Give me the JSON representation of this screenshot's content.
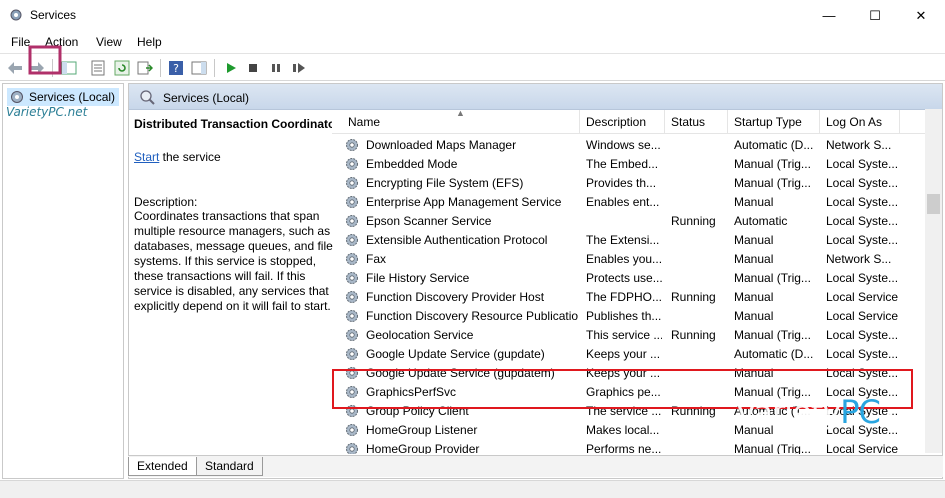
{
  "window": {
    "title": "Services",
    "minimize": "—",
    "maximize": "☐",
    "close": "✕"
  },
  "menu": [
    "File",
    "Action",
    "View",
    "Help"
  ],
  "tree": {
    "root_label": "Services (Local)"
  },
  "pane_header": "Services (Local)",
  "detail": {
    "service_name": "Distributed Transaction Coordinator",
    "start_link": "Start",
    "start_suffix": " the service",
    "description_label": "Description:",
    "description_text": "Coordinates transactions that span multiple resource managers, such as databases, message queues, and file systems. If this service is stopped, these transactions will fail. If this service is disabled, any services that explicitly depend on it will fail to start."
  },
  "columns": [
    "Name",
    "Description",
    "Status",
    "Startup Type",
    "Log On As"
  ],
  "rows": [
    {
      "name": "Downloaded Maps Manager",
      "description": "Windows se...",
      "status": "",
      "startup": "Automatic (D...",
      "logon": "Network S..."
    },
    {
      "name": "Embedded Mode",
      "description": "The Embed...",
      "status": "",
      "startup": "Manual (Trig...",
      "logon": "Local Syste..."
    },
    {
      "name": "Encrypting File System (EFS)",
      "description": "Provides th...",
      "status": "",
      "startup": "Manual (Trig...",
      "logon": "Local Syste..."
    },
    {
      "name": "Enterprise App Management Service",
      "description": "Enables ent...",
      "status": "",
      "startup": "Manual",
      "logon": "Local Syste..."
    },
    {
      "name": "Epson Scanner Service",
      "description": "",
      "status": "Running",
      "startup": "Automatic",
      "logon": "Local Syste..."
    },
    {
      "name": "Extensible Authentication Protocol",
      "description": "The Extensi...",
      "status": "",
      "startup": "Manual",
      "logon": "Local Syste..."
    },
    {
      "name": "Fax",
      "description": "Enables you...",
      "status": "",
      "startup": "Manual",
      "logon": "Network S..."
    },
    {
      "name": "File History Service",
      "description": "Protects use...",
      "status": "",
      "startup": "Manual (Trig...",
      "logon": "Local Syste..."
    },
    {
      "name": "Function Discovery Provider Host",
      "description": "The FDPHO...",
      "status": "Running",
      "startup": "Manual",
      "logon": "Local Service"
    },
    {
      "name": "Function Discovery Resource Publication",
      "description": "Publishes th...",
      "status": "",
      "startup": "Manual",
      "logon": "Local Service"
    },
    {
      "name": "Geolocation Service",
      "description": "This service ...",
      "status": "Running",
      "startup": "Manual (Trig...",
      "logon": "Local Syste..."
    },
    {
      "name": "Google Update Service (gupdate)",
      "description": "Keeps your ...",
      "status": "",
      "startup": "Automatic (D...",
      "logon": "Local Syste..."
    },
    {
      "name": "Google Update Service (gupdatem)",
      "description": "Keeps your ...",
      "status": "",
      "startup": "Manual",
      "logon": "Local Syste..."
    },
    {
      "name": "GraphicsPerfSvc",
      "description": "Graphics pe...",
      "status": "",
      "startup": "Manual (Trig...",
      "logon": "Local Syste..."
    },
    {
      "name": "Group Policy Client",
      "description": "The service ...",
      "status": "Running",
      "startup": "Automatic (T...",
      "logon": "Local Syste..."
    },
    {
      "name": "HomeGroup Listener",
      "description": "Makes local...",
      "status": "",
      "startup": "Manual",
      "logon": "Local Syste..."
    },
    {
      "name": "HomeGroup Provider",
      "description": "Performs ne...",
      "status": "",
      "startup": "Manual (Trig...",
      "logon": "Local Service"
    }
  ],
  "tabs": [
    "Extended",
    "Standard"
  ],
  "watermark": {
    "small": "VarietyPC.net",
    "big_main": "Variety",
    "big_pc": "PC",
    "big_tld": ".net"
  },
  "colors": {
    "highlight_box": "#e0181e",
    "link": "#1f5fbf",
    "header_band": "#c8d7ea"
  }
}
